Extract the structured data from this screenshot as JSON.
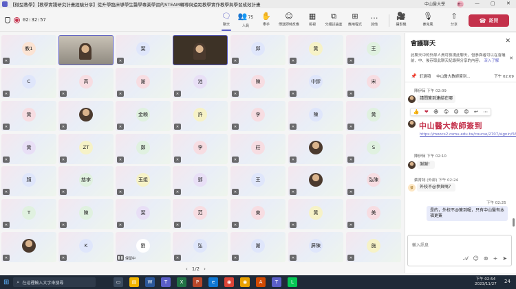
{
  "window": {
    "title": "【微型教學】【教學實踐研究計畫經驗分享】從升學臨床導學生醫學專業學習的STEAM轉導與遠距教學實作教學與學習成效計畫",
    "org": "中山醫大學",
    "user_initials": "教1"
  },
  "toolbar": {
    "timer": "02:32:57",
    "buttons": [
      {
        "label": "聊天",
        "icon": "chat-icon",
        "glyph": "🗨"
      },
      {
        "label": "人員",
        "icon": "people-icon",
        "glyph": "👥",
        "count": "75"
      },
      {
        "label": "舉手",
        "icon": "raise-hand-icon",
        "glyph": "✋"
      },
      {
        "label": "傳送即時反應",
        "icon": "react-icon",
        "glyph": "☺"
      },
      {
        "label": "檢視",
        "icon": "view-icon",
        "glyph": "▦"
      },
      {
        "label": "分組討論室",
        "icon": "breakout-icon",
        "glyph": "⧉"
      },
      {
        "label": "應用程式",
        "icon": "apps-icon",
        "glyph": "⊞"
      },
      {
        "label": "其他",
        "icon": "more-icon",
        "glyph": "…"
      },
      {
        "label": "攝影機",
        "icon": "camera-icon",
        "glyph": "🎥"
      },
      {
        "label": "麥克風",
        "icon": "mic-icon",
        "glyph": "🎙"
      },
      {
        "label": "分享",
        "icon": "share-icon",
        "glyph": "⇧"
      }
    ],
    "leave_label": "離開"
  },
  "grid": {
    "tiles": [
      {
        "label": "教1",
        "color": "#fbe3d3"
      },
      {
        "label": "",
        "video": true
      },
      {
        "label": "葉",
        "color": "#dfe6fb"
      },
      {
        "label": "",
        "video": true,
        "dark": true
      },
      {
        "label": "邱",
        "color": "#dfe6fb"
      },
      {
        "label": "黃",
        "color": "#f6f2c7"
      },
      {
        "label": "王",
        "color": "#e0f1e0"
      },
      {
        "label": "C",
        "color": "#dfe6fb"
      },
      {
        "label": "高",
        "color": "#f7dde2"
      },
      {
        "label": "謝",
        "color": "#f7dde2"
      },
      {
        "label": "池",
        "color": "#e8dff6"
      },
      {
        "label": "陳",
        "color": "#f7dde2"
      },
      {
        "label": "中膠",
        "color": "#dfe6fb"
      },
      {
        "label": "宋",
        "color": "#f7dde2"
      },
      {
        "label": "黃",
        "color": "#f7dde2"
      },
      {
        "label": "",
        "photo": true
      },
      {
        "label": "金賴",
        "color": "#e0f1e0"
      },
      {
        "label": "許",
        "color": "#f6f2c7"
      },
      {
        "label": "李",
        "color": "#f7dde2"
      },
      {
        "label": "陳",
        "color": "#dfe6fb"
      },
      {
        "label": "黃",
        "color": "#e0f1e0"
      },
      {
        "label": "黃",
        "color": "#e8dff6"
      },
      {
        "label": "ZT",
        "color": "#f6f2c7"
      },
      {
        "label": "鄭",
        "color": "#e0f1e0"
      },
      {
        "label": "李",
        "color": "#f7dde2"
      },
      {
        "label": "莊",
        "color": "#f7dde2"
      },
      {
        "label": "",
        "photo": true
      },
      {
        "label": "S",
        "color": "#e0f1e0"
      },
      {
        "label": "顏",
        "color": "#dfe6fb"
      },
      {
        "label": "慈李",
        "color": "#e0f1e0"
      },
      {
        "label": "玉姐",
        "color": "#f6f2c7"
      },
      {
        "label": "鄧",
        "color": "#e8dff6"
      },
      {
        "label": "王",
        "color": "#dfe6fb"
      },
      {
        "label": "",
        "photo": true
      },
      {
        "label": "弘陳",
        "color": "#f7dde2"
      },
      {
        "label": "T",
        "color": "#e0f1e0"
      },
      {
        "label": "陳",
        "color": "#e0f1e0"
      },
      {
        "label": "葉",
        "color": "#e8dff6"
      },
      {
        "label": "范",
        "color": "#f7dde2"
      },
      {
        "label": "東",
        "color": "#f7dde2"
      },
      {
        "label": "黃",
        "color": "#f6f2c7"
      },
      {
        "label": "美",
        "color": "#f7dde2"
      },
      {
        "label": "",
        "photo": true
      },
      {
        "label": "K",
        "color": "#dfe6fb"
      },
      {
        "label": "劉",
        "color": "#ffffff",
        "status": "保留中"
      },
      {
        "label": "弘",
        "color": "#dfe6fb"
      },
      {
        "label": "謝",
        "color": "#dfe6fb"
      },
      {
        "label": "屏陳",
        "color": "#dfe6fb"
      },
      {
        "label": "施",
        "color": "#f6f2c7"
      }
    ],
    "pager": "1/2"
  },
  "chat": {
    "title": "會議聊天",
    "notice": "此聊天中的外部人員可檢視此聊天，但參與者可以在會議前、中、後存取此聊天紀錄與分享的內容。",
    "notice_link": "深入了解",
    "pinned_by": "釘選項",
    "pinned_preview": "中山醫大教師簽到...",
    "pinned_time": "下午 02:09",
    "messages": [
      {
        "sender": "陳伊茹",
        "time": "下午 02:09",
        "text": "請問簽到連結在哪"
      },
      {
        "sender": "",
        "time": "",
        "title": "中山醫大教師簽到",
        "link": "https://moocs2.csmu.edu.tw/course/2707/signin/5666"
      },
      {
        "sender": "陳伊茹",
        "time": "下午 02:10",
        "text": "謝謝！"
      },
      {
        "sender": "蔡育誌 (外部)",
        "time": "下午 02:24",
        "text": "外校不@參與嗎？",
        "initials": "蔡"
      },
      {
        "sender": "",
        "time": "下午 02:25",
        "text": "是的，外校不@簽到喔，只有中山醫有本福更簽",
        "mine": true
      }
    ],
    "reactions": [
      "👍",
      "❤",
      "😆",
      "😮",
      "😢",
      "😠",
      "↩",
      "⋯"
    ],
    "compose_placeholder": "輸入訊息"
  },
  "taskbar": {
    "search_placeholder": "在這裡輸入文字來搜尋",
    "time": "下午 02:54",
    "date": "2023/11/27",
    "notif": "24"
  }
}
